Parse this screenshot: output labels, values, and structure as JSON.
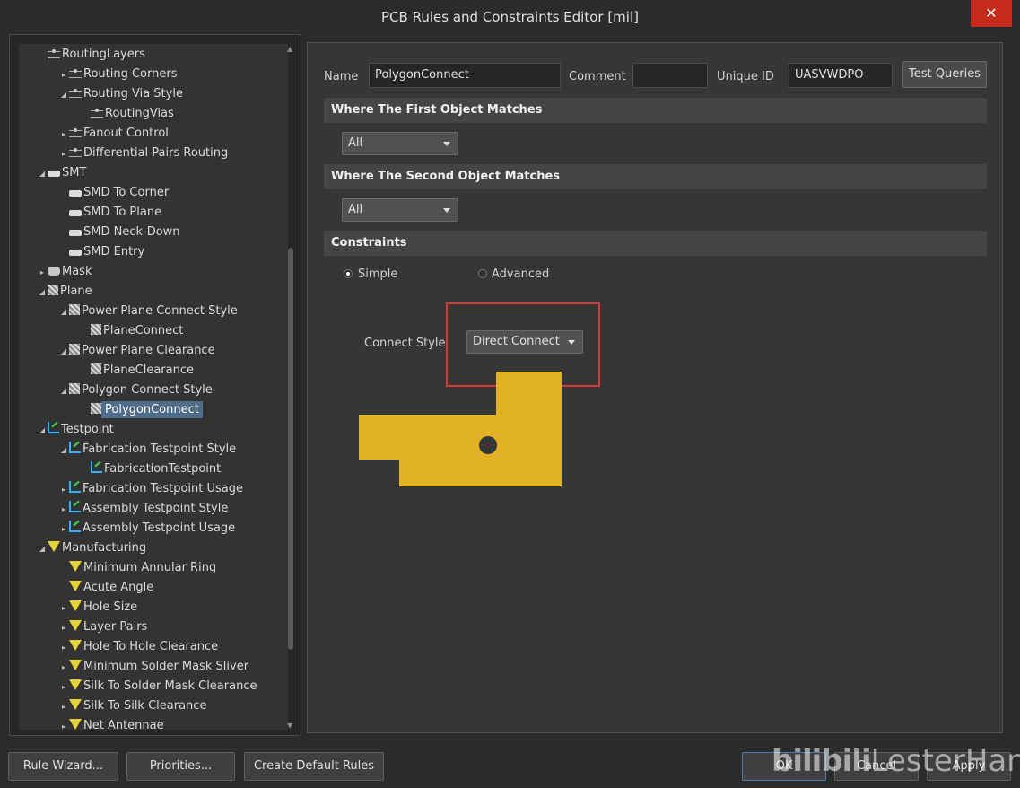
{
  "window": {
    "title": "PCB Rules and Constraints Editor [mil]",
    "close_glyph": "✕"
  },
  "tree": {
    "items": [
      {
        "label": "RoutingLayers",
        "arrow": "",
        "icon": "routing-icon"
      },
      {
        "label": "Routing Corners",
        "arrow": "▸",
        "icon": "routing-icon"
      },
      {
        "label": "Routing Via Style",
        "arrow": "◢",
        "icon": "routing-icon"
      },
      {
        "label": "RoutingVias",
        "arrow": "",
        "icon": "routing-icon"
      },
      {
        "label": "Fanout Control",
        "arrow": "▸",
        "icon": "routing-icon"
      },
      {
        "label": "Differential Pairs Routing",
        "arrow": "▸",
        "icon": "routing-icon"
      },
      {
        "label": "SMT",
        "arrow": "◢",
        "icon": "smt-icon"
      },
      {
        "label": "SMD To Corner",
        "arrow": "",
        "icon": "smt-icon"
      },
      {
        "label": "SMD To Plane",
        "arrow": "",
        "icon": "smt-icon"
      },
      {
        "label": "SMD Neck-Down",
        "arrow": "",
        "icon": "smt-icon"
      },
      {
        "label": "SMD Entry",
        "arrow": "",
        "icon": "smt-icon"
      },
      {
        "label": "Mask",
        "arrow": "▸",
        "icon": "mask-icon"
      },
      {
        "label": "Plane",
        "arrow": "◢",
        "icon": "plane-icon"
      },
      {
        "label": "Power Plane Connect Style",
        "arrow": "◢",
        "icon": "plane-icon"
      },
      {
        "label": "PlaneConnect",
        "arrow": "",
        "icon": "plane-icon"
      },
      {
        "label": "Power Plane Clearance",
        "arrow": "◢",
        "icon": "plane-icon"
      },
      {
        "label": "PlaneClearance",
        "arrow": "",
        "icon": "plane-icon"
      },
      {
        "label": "Polygon Connect Style",
        "arrow": "◢",
        "icon": "plane-icon"
      },
      {
        "label": "PolygonConnect",
        "arrow": "",
        "icon": "plane-icon"
      },
      {
        "label": "Testpoint",
        "arrow": "◢",
        "icon": "testpoint-icon"
      },
      {
        "label": "Fabrication Testpoint Style",
        "arrow": "◢",
        "icon": "testpoint-icon"
      },
      {
        "label": "FabricationTestpoint",
        "arrow": "",
        "icon": "testpoint-icon"
      },
      {
        "label": "Fabrication Testpoint Usage",
        "arrow": "▸",
        "icon": "testpoint-icon"
      },
      {
        "label": "Assembly Testpoint Style",
        "arrow": "▸",
        "icon": "testpoint-icon"
      },
      {
        "label": "Assembly Testpoint Usage",
        "arrow": "▸",
        "icon": "testpoint-icon"
      },
      {
        "label": "Manufacturing",
        "arrow": "◢",
        "icon": "manufacturing-icon"
      },
      {
        "label": "Minimum Annular Ring",
        "arrow": "",
        "icon": "manufacturing-icon"
      },
      {
        "label": "Acute Angle",
        "arrow": "",
        "icon": "manufacturing-icon"
      },
      {
        "label": "Hole Size",
        "arrow": "▸",
        "icon": "manufacturing-icon"
      },
      {
        "label": "Layer Pairs",
        "arrow": "▸",
        "icon": "manufacturing-icon"
      },
      {
        "label": "Hole To Hole Clearance",
        "arrow": "▸",
        "icon": "manufacturing-icon"
      },
      {
        "label": "Minimum Solder Mask Sliver",
        "arrow": "▸",
        "icon": "manufacturing-icon"
      },
      {
        "label": "Silk To Solder Mask Clearance",
        "arrow": "▸",
        "icon": "manufacturing-icon"
      },
      {
        "label": "Silk To Silk Clearance",
        "arrow": "▸",
        "icon": "manufacturing-icon"
      },
      {
        "label": "Net Antennae",
        "arrow": "▸",
        "icon": "manufacturing-icon"
      }
    ]
  },
  "rule": {
    "name_label": "Name",
    "name_value": "PolygonConnect",
    "comment_label": "Comment",
    "comment_value": "",
    "unique_id_label": "Unique ID",
    "unique_id_value": "UASVWDPO",
    "test_queries_label": "Test Queries"
  },
  "first_match": {
    "heading": "Where The First Object Matches",
    "selected": "All"
  },
  "second_match": {
    "heading": "Where The Second Object Matches",
    "selected": "All"
  },
  "constraints": {
    "heading": "Constraints",
    "simple_label": "Simple",
    "advanced_label": "Advanced",
    "selected_mode": "Simple",
    "connect_style_label": "Connect Style",
    "connect_style_value": "Direct Connect"
  },
  "footer": {
    "rule_wizard": "Rule Wizard...",
    "priorities": "Priorities...",
    "create_defaults": "Create Default Rules",
    "ok": "OK",
    "cancel": "Cancel",
    "apply": "Apply"
  },
  "watermark": {
    "logo_text": "bilibili",
    "author": "LesterHan"
  },
  "colors": {
    "polygon_fill": "#e2b225",
    "highlight_border": "#e0363a",
    "selection": "#4f6d8a"
  }
}
